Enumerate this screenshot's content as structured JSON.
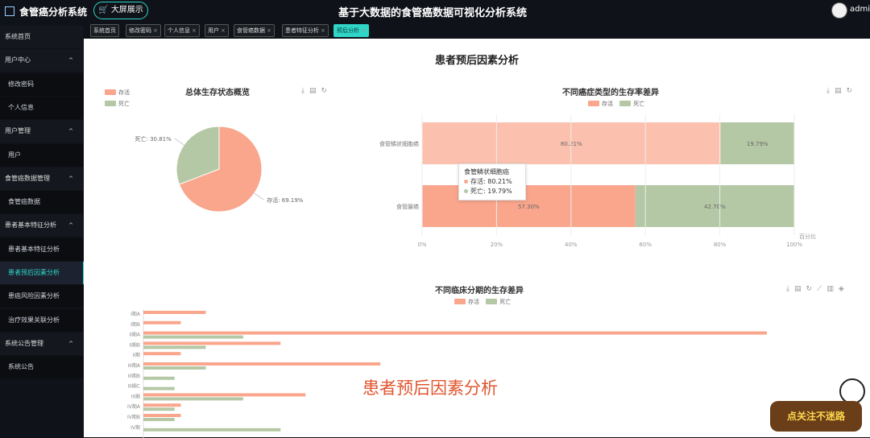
{
  "app": {
    "logo_text": "食管癌分析系统",
    "bigscreen_label": "大屏展示",
    "title": "基于大数据的食管癌数据可视化分析系统",
    "user": "admin"
  },
  "tabs": [
    {
      "label": "系统首页",
      "closable": false
    },
    {
      "label": "修改密码",
      "closable": true
    },
    {
      "label": "个人信息",
      "closable": true
    },
    {
      "label": "用户",
      "closable": true
    },
    {
      "label": "食管癌数据",
      "closable": true
    },
    {
      "label": "患者特征分析",
      "closable": true
    },
    {
      "label": "预后分析",
      "closable": true,
      "active": true
    }
  ],
  "sidebar": {
    "items": [
      {
        "label": "系统首页",
        "type": "group"
      },
      {
        "label": "用户中心",
        "type": "group",
        "arrow": "^"
      },
      {
        "label": "修改密码",
        "type": "sub"
      },
      {
        "label": "个人信息",
        "type": "sub"
      },
      {
        "label": "用户管理",
        "type": "group",
        "arrow": "^"
      },
      {
        "label": "用户",
        "type": "sub"
      },
      {
        "label": "食管癌数据管理",
        "type": "group",
        "arrow": "^"
      },
      {
        "label": "食管癌数据",
        "type": "sub"
      },
      {
        "label": "患者基本特征分析",
        "type": "group",
        "arrow": "^"
      },
      {
        "label": "患者基本特征分析",
        "type": "sub"
      },
      {
        "label": "患者预后因素分析",
        "type": "sub",
        "active": true
      },
      {
        "label": "患癌风险因素分析",
        "type": "sub"
      },
      {
        "label": "治疗效果关联分析",
        "type": "sub"
      },
      {
        "label": "系统公告管理",
        "type": "group",
        "arrow": "^"
      },
      {
        "label": "系统公告",
        "type": "sub"
      }
    ]
  },
  "page": {
    "title": "患者预后因素分析"
  },
  "colors": {
    "alive": "#f9a68c",
    "dead": "#b5c8a5",
    "accent": "#2fd6c8"
  },
  "tooltip": {
    "title": "食管鳞状细胞癌",
    "rows": [
      "存活: 80.21%",
      "死亡: 19.79%"
    ]
  },
  "watermark": "患者预后因素分析",
  "badge": "点关注不迷路",
  "chart_data": [
    {
      "type": "pie",
      "title": "总体生存状态概览",
      "legend": [
        "存活",
        "死亡"
      ],
      "slices": [
        {
          "name": "存活",
          "value": 69.19,
          "label": "存活: 69.19%"
        },
        {
          "name": "死亡",
          "value": 30.81,
          "label": "死亡: 30.81%"
        }
      ]
    },
    {
      "type": "bar",
      "orientation": "horizontal-stacked",
      "title": "不同癌症类型的生存率差异",
      "legend": [
        "存活",
        "死亡"
      ],
      "categories": [
        "食管鳞状细胞癌",
        "食管腺癌"
      ],
      "series": [
        {
          "name": "存活",
          "values": [
            80.21,
            57.3
          ],
          "labels": [
            "80.21%",
            "57.30%"
          ]
        },
        {
          "name": "死亡",
          "values": [
            19.79,
            42.7
          ],
          "labels": [
            "19.79%",
            "42.70%"
          ]
        }
      ],
      "xticks": [
        "0%",
        "20%",
        "40%",
        "60%",
        "80%",
        "100%"
      ],
      "xlabel": "百分比"
    },
    {
      "type": "bar",
      "orientation": "horizontal-grouped",
      "title": "不同临床分期的生存差异",
      "legend": [
        "存活",
        "死亡"
      ],
      "categories": [
        "I期A",
        "I期B",
        "II期A",
        "II期B",
        "II期",
        "III期A",
        "III期B",
        "III期C",
        "III期",
        "IV期A",
        "IV期B",
        "IV期"
      ],
      "series": [
        {
          "name": "存活",
          "values": [
            10,
            6,
            100,
            22,
            6,
            38,
            0,
            0,
            26,
            6,
            6,
            0
          ]
        },
        {
          "name": "死亡",
          "values": [
            0,
            0,
            16,
            10,
            0,
            10,
            5,
            5,
            16,
            5,
            5,
            22
          ]
        }
      ],
      "xmax": 100
    }
  ]
}
